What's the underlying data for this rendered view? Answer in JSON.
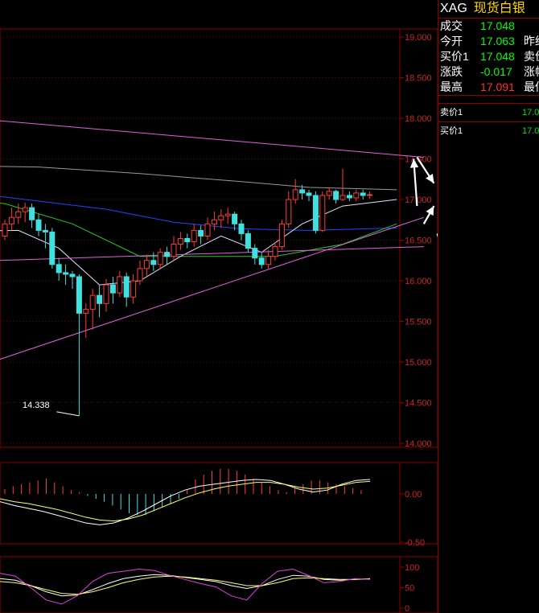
{
  "quote": {
    "code": "XAG",
    "name": "现货白银",
    "rows": [
      {
        "label": "成交",
        "value": "17.048",
        "color": "#00ff00",
        "trail": ""
      },
      {
        "label": "今开",
        "value": "17.063",
        "color": "#00ff00",
        "trail": "昨结"
      },
      {
        "label": "买价1",
        "value": "17.048",
        "color": "#00ff00",
        "trail": "卖价"
      },
      {
        "label": "涨跌",
        "value": "-0.017",
        "color": "#00ff00",
        "trail": "涨幅"
      },
      {
        "label": "最高",
        "value": "17.091",
        "color": "#ff3030",
        "trail": "最低"
      }
    ],
    "sell": {
      "label": "卖价1",
      "value": "17.0"
    },
    "buy": {
      "label": "买价1",
      "value": "17.0"
    }
  },
  "chart_data": {
    "type": "candlestick",
    "price_axis": {
      "ticks": [
        "19.000",
        "18.500",
        "18.000",
        "17.500",
        "17.000",
        "16.500",
        "16.000",
        "15.500",
        "15.000",
        "14.500",
        "14.000"
      ],
      "ylim": [
        14.0,
        19.2
      ]
    },
    "low_annotation": {
      "text": "14.338",
      "value": 14.338
    },
    "colors": {
      "up": "#ff3c3c",
      "down": "#40e0e0",
      "grid": "#8b0000",
      "axis_text": "#cc2222"
    },
    "candles": [
      [
        16.55,
        16.7,
        16.5,
        16.75
      ],
      [
        16.7,
        16.78,
        16.62,
        16.9
      ],
      [
        16.78,
        16.85,
        16.7,
        16.95
      ],
      [
        16.85,
        16.9,
        16.72,
        16.96
      ],
      [
        16.9,
        16.75,
        16.65,
        16.95
      ],
      [
        16.75,
        16.62,
        16.55,
        16.82
      ],
      [
        16.62,
        16.6,
        16.4,
        16.7
      ],
      [
        16.6,
        16.2,
        16.15,
        16.65
      ],
      [
        16.2,
        16.1,
        16.0,
        16.28
      ],
      [
        16.1,
        16.08,
        15.95,
        16.2
      ],
      [
        16.08,
        16.05,
        15.9,
        16.12
      ],
      [
        16.05,
        15.6,
        14.34,
        16.08
      ],
      [
        15.6,
        15.65,
        15.3,
        15.72
      ],
      [
        15.65,
        15.82,
        15.4,
        15.9
      ],
      [
        15.82,
        15.72,
        15.55,
        15.95
      ],
      [
        15.72,
        15.95,
        15.62,
        16.02
      ],
      [
        15.95,
        15.85,
        15.72,
        16.05
      ],
      [
        15.85,
        16.05,
        15.8,
        16.12
      ],
      [
        16.05,
        15.8,
        15.68,
        16.1
      ],
      [
        15.8,
        16.0,
        15.72,
        16.08
      ],
      [
        16.0,
        16.15,
        15.95,
        16.25
      ],
      [
        16.15,
        16.25,
        16.05,
        16.32
      ],
      [
        16.25,
        16.2,
        16.12,
        16.35
      ],
      [
        16.2,
        16.35,
        16.15,
        16.4
      ],
      [
        16.35,
        16.3,
        16.2,
        16.42
      ],
      [
        16.3,
        16.45,
        16.25,
        16.55
      ],
      [
        16.45,
        16.52,
        16.38,
        16.6
      ],
      [
        16.52,
        16.48,
        16.4,
        16.58
      ],
      [
        16.48,
        16.62,
        16.42,
        16.7
      ],
      [
        16.62,
        16.55,
        16.45,
        16.68
      ],
      [
        16.55,
        16.7,
        16.5,
        16.78
      ],
      [
        16.7,
        16.75,
        16.62,
        16.85
      ],
      [
        16.75,
        16.8,
        16.65,
        16.88
      ],
      [
        16.8,
        16.82,
        16.7,
        16.9
      ],
      [
        16.82,
        16.7,
        16.62,
        16.85
      ],
      [
        16.7,
        16.58,
        16.5,
        16.75
      ],
      [
        16.58,
        16.4,
        16.35,
        16.62
      ],
      [
        16.4,
        16.28,
        16.2,
        16.45
      ],
      [
        16.28,
        16.2,
        16.15,
        16.35
      ],
      [
        16.2,
        16.3,
        16.15,
        16.38
      ],
      [
        16.3,
        16.42,
        16.25,
        16.48
      ],
      [
        16.42,
        16.7,
        16.38,
        16.75
      ],
      [
        16.7,
        17.0,
        16.65,
        17.1
      ],
      [
        17.0,
        17.12,
        16.95,
        17.25
      ],
      [
        17.12,
        17.08,
        17.0,
        17.18
      ],
      [
        17.08,
        17.05,
        16.98,
        17.12
      ],
      [
        17.05,
        16.62,
        16.58,
        17.1
      ],
      [
        16.62,
        17.05,
        16.6,
        17.1
      ],
      [
        17.05,
        17.1,
        17.0,
        17.15
      ],
      [
        17.1,
        17.0,
        16.95,
        17.12
      ],
      [
        17.0,
        17.05,
        16.98,
        17.38
      ],
      [
        17.05,
        17.02,
        16.98,
        17.1
      ],
      [
        17.02,
        17.08,
        16.98,
        17.12
      ],
      [
        17.08,
        17.05,
        17.0,
        17.12
      ],
      [
        17.05,
        17.06,
        17.01,
        17.1
      ]
    ],
    "trendlines": [
      {
        "name": "",
        "from": [
          -12,
          18.05
        ],
        "to": [
          62,
          17.52
        ],
        "color": "#e060e0"
      },
      {
        "name": "",
        "from": [
          -12,
          14.72
        ],
        "to": [
          62,
          16.78
        ],
        "color": "#e060e0"
      },
      {
        "name": "",
        "from": [
          -12,
          16.22
        ],
        "to": [
          62,
          16.42
        ],
        "color": "#e060e0"
      }
    ],
    "moving_averages": [
      {
        "color": "#9a9a9a",
        "values_at": [
          [
            -12,
            17.42
          ],
          [
            5,
            17.4
          ],
          [
            20,
            17.32
          ],
          [
            35,
            17.22
          ],
          [
            45,
            17.15
          ],
          [
            58,
            17.12
          ]
        ]
      },
      {
        "color": "#2244ff",
        "values_at": [
          [
            -12,
            17.15
          ],
          [
            5,
            16.98
          ],
          [
            15,
            16.88
          ],
          [
            25,
            16.72
          ],
          [
            35,
            16.64
          ],
          [
            45,
            16.62
          ],
          [
            58,
            16.65
          ]
        ]
      },
      {
        "color": "#22cc22",
        "values_at": [
          [
            -12,
            17.05
          ],
          [
            0,
            16.95
          ],
          [
            10,
            16.7
          ],
          [
            20,
            16.3
          ],
          [
            30,
            16.3
          ],
          [
            40,
            16.3
          ],
          [
            50,
            16.45
          ],
          [
            58,
            16.7
          ]
        ]
      },
      {
        "color": "#e0e0ff",
        "values_at": [
          [
            -12,
            16.6
          ],
          [
            2,
            16.62
          ],
          [
            8,
            16.4
          ],
          [
            14,
            15.95
          ],
          [
            20,
            16.0
          ],
          [
            26,
            16.3
          ],
          [
            32,
            16.55
          ],
          [
            38,
            16.35
          ],
          [
            44,
            16.7
          ],
          [
            50,
            16.92
          ],
          [
            58,
            17.0
          ]
        ]
      }
    ],
    "forecast_arrows": [
      [
        [
          61,
          17.52
        ],
        [
          63.5,
          17.2
        ]
      ],
      [
        [
          62,
          16.7
        ],
        [
          63.5,
          16.92
        ]
      ],
      [
        [
          61,
          16.92
        ],
        [
          60.5,
          17.5
        ]
      ],
      [
        [
          64,
          16.58
        ],
        [
          67,
          15.8
        ]
      ],
      [
        [
          67,
          15.8
        ],
        [
          69.5,
          16.2
        ]
      ],
      [
        [
          69.5,
          16.2
        ],
        [
          73,
          14.98
        ]
      ]
    ],
    "macd": {
      "ticks": [
        "0.00",
        "-0.50"
      ],
      "dif": [
        -0.08,
        -0.12,
        -0.15,
        -0.18,
        -0.22,
        -0.26,
        -0.3,
        -0.32,
        -0.3,
        -0.25,
        -0.18,
        -0.1,
        -0.02,
        0.04,
        0.08,
        0.1,
        0.12,
        0.14,
        0.15,
        0.14,
        0.1,
        0.05,
        0.02,
        0.04,
        0.1,
        0.14,
        0.15
      ],
      "dea": [
        -0.05,
        -0.08,
        -0.1,
        -0.13,
        -0.16,
        -0.2,
        -0.24,
        -0.27,
        -0.28,
        -0.26,
        -0.22,
        -0.16,
        -0.1,
        -0.04,
        0.01,
        0.05,
        0.08,
        0.1,
        0.12,
        0.12,
        0.1,
        0.07,
        0.05,
        0.06,
        0.09,
        0.12,
        0.13
      ],
      "hist": [
        0.05,
        0.08,
        0.1,
        0.12,
        0.14,
        0.16,
        0.12,
        0.08,
        0.04,
        0.02,
        -0.02,
        -0.05,
        -0.08,
        -0.12,
        -0.16,
        -0.2,
        -0.22,
        -0.22,
        -0.18,
        -0.14,
        -0.1,
        -0.05,
        0.05,
        0.15,
        0.2,
        0.24,
        0.26,
        0.26,
        0.24,
        0.2,
        0.16,
        0.12,
        0.08,
        0.04,
        0.02,
        0.06,
        0.1,
        0.14,
        0.14,
        0.12,
        0.1,
        0.08,
        0.06,
        0.04
      ]
    },
    "kdj": {
      "ticks": [
        "100",
        "50",
        "0"
      ],
      "k": [
        72,
        68,
        55,
        40,
        30,
        32,
        45,
        60,
        72,
        78,
        82,
        80,
        75,
        70,
        65,
        55,
        48,
        55,
        70,
        80,
        78,
        70,
        68,
        70,
        72
      ],
      "d": [
        65,
        62,
        55,
        45,
        36,
        34,
        40,
        50,
        62,
        70,
        76,
        78,
        76,
        72,
        68,
        62,
        55,
        55,
        62,
        72,
        74,
        72,
        70,
        70,
        71
      ],
      "j": [
        85,
        78,
        50,
        20,
        10,
        30,
        65,
        85,
        90,
        95,
        92,
        80,
        70,
        60,
        52,
        30,
        20,
        60,
        90,
        95,
        80,
        62,
        65,
        72,
        70
      ]
    }
  }
}
